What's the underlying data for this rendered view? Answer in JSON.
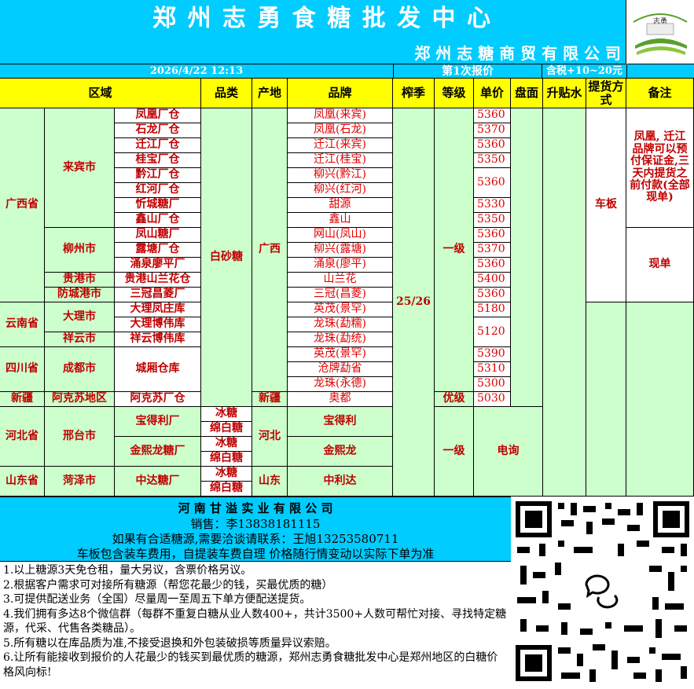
{
  "header": {
    "title": "郑 州 志 勇 食 糖 批 发 中 心",
    "subtitle": "郑 州 志 糖 商 贸 有 限 公 司",
    "datetime": "2026/4/22  12:13",
    "report_no": "第1次报价",
    "tax_note": "含税+10~20元",
    "logo_text": "志勇"
  },
  "columns": {
    "region": "区域",
    "category": "品类",
    "origin": "产地",
    "brand": "品牌",
    "season": "榨季",
    "grade": "等级",
    "price": "单价",
    "panmian": "盘面",
    "shengtieshui": "升贴水",
    "delivery": "提货方式",
    "remarks": "备注"
  },
  "regions": {
    "guangxi": "广西省",
    "yunnan": "云南省",
    "sichuan": "四川省",
    "xinjiang": "新疆",
    "hebei": "河北省",
    "shandong": "山东省"
  },
  "cities": {
    "laibin": "来宾市",
    "liuzhou": "柳州市",
    "guigang": "贵港市",
    "fangchenggang": "防城港市",
    "dali": "大理市",
    "xiangyun": "祥云市",
    "chengdu": "成都市",
    "akesu": "阿克苏地区",
    "xingtai": "邢台市",
    "heze": "菏泽市"
  },
  "warehouses": [
    "凤凰厂仓",
    "石龙厂仓",
    "迁江厂仓",
    "桂宝厂仓",
    "黔江厂仓",
    "红河厂仓",
    "忻城糖厂",
    "鑫山厂仓",
    "凤山糖厂",
    "露塘厂仓",
    "涌泉廖平厂",
    "贵港山兰花仓",
    "三冠昌菱厂",
    "大理凤庄库",
    "大理博伟库",
    "祥云博伟库",
    "城厢仓库",
    "阿克苏厂仓",
    "宝得利厂",
    "金熙龙糖厂",
    "中达糖厂"
  ],
  "categories": {
    "baishatang": "白砂糖",
    "bingtang": "冰糖",
    "mianbaitang": "绵白糖"
  },
  "origins": {
    "guangxi": "广西",
    "xinjiang": "新疆",
    "hebei": "河北",
    "shandong": "山东"
  },
  "brands": [
    "凤凰(来宾)",
    "凤凰(石龙)",
    "迁江(来宾)",
    "迁江(桂宝)",
    "柳兴(黔江)",
    "柳兴(红河)",
    "甜源",
    "鑫山",
    "网山(凤山)",
    "柳兴(露塘)",
    "涌泉(廖平)",
    "山兰花",
    "三冠(昌菱)",
    "英茂(景罕)",
    "龙珠(勐糯)",
    "龙珠(勐统)",
    "英茂(景罕)",
    "沧牌勐省",
    "龙珠(永德)",
    "奥都",
    "宝得利",
    "金熙龙",
    "中利达"
  ],
  "season": "25/26",
  "grades": {
    "yiji": "一级",
    "youji": "优级",
    "yiji2": "一级"
  },
  "prices": [
    "5360",
    "5370",
    "5360",
    "5350",
    "5360",
    "5330",
    "5350",
    "5360",
    "5370",
    "5360",
    "5400",
    "5360",
    "5180",
    "5120",
    "5390",
    "5310",
    "5300",
    "5030"
  ],
  "panmian_note": "电询",
  "delivery": "车板",
  "remarks": {
    "r1": "凤凰, 迁江品牌可以预付保证金,三天内提货之前付款(全部现单)",
    "r2": "现单"
  },
  "footer": {
    "company": "河 南 甘 溢 实 业 有 限 公 司",
    "sales": "销售：李13838181115",
    "contact": "如果有合适糖源,需要洽谈请联系：王旭13253580711",
    "note": "车板包含装车费用，自提装车费自理     价格随行情变动以实际下单为准",
    "notes": [
      "1.以上糖源3天免仓租，量大另议，含票价格另议。",
      "2.根据客户需求可对接所有糖源（帮您花最少的钱，买最优质的糖）",
      "3.可提供配送业务（全国）尽量周一至周五下单方便配送提货。",
      "4.我们拥有多达8个微信群（每群不重复白糖从业人数400+，共计3500+人数可帮忙对接、寻找特定糖源，代采、代售各类糖品）。",
      "5.所有糖以在库品质为准,不接受退换和外包装破损等质量异议索赔。",
      "6.让所有能接收到报价的人花最少的钱买到最优质的糖源，郑州志勇食糖批发中心是郑州地区的白糖价格风向标!"
    ]
  },
  "colors": {
    "cyan": "#00ccff",
    "green": "#ccffcc",
    "yellow": "#ffff00",
    "red": "#e00000"
  }
}
